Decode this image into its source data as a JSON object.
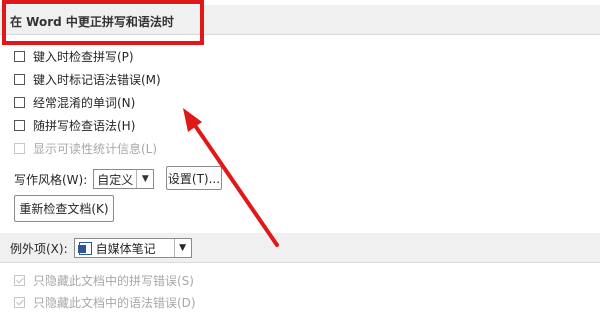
{
  "proofing_section": {
    "title": "在 Word 中更正拼写和语法时",
    "options": [
      {
        "label": "键入时检查拼写(P)",
        "checked": false,
        "enabled": true
      },
      {
        "label": "键入时标记语法错误(M)",
        "checked": false,
        "enabled": true
      },
      {
        "label": "经常混淆的单词(N)",
        "checked": false,
        "enabled": true
      },
      {
        "label": "随拼写检查语法(H)",
        "checked": false,
        "enabled": true
      },
      {
        "label": "显示可读性统计信息(L)",
        "checked": false,
        "enabled": false
      }
    ],
    "writing_style_label": "写作风格(W):",
    "writing_style_value": "自定义",
    "settings_button": "设置(T)...",
    "recheck_button": "重新检查文档(K)"
  },
  "exceptions_section": {
    "label": "例外项(X):",
    "document_value": "自媒体笔记",
    "options": [
      {
        "label": "只隐藏此文档中的拼写错误(S)",
        "checked": true,
        "enabled": false
      },
      {
        "label": "只隐藏此文档中的语法错误(D)",
        "checked": true,
        "enabled": false
      }
    ]
  },
  "annotation": {
    "color": "#e21717"
  },
  "icons": {
    "dropdown": "chevron-down-icon",
    "document": "word-document-icon"
  }
}
